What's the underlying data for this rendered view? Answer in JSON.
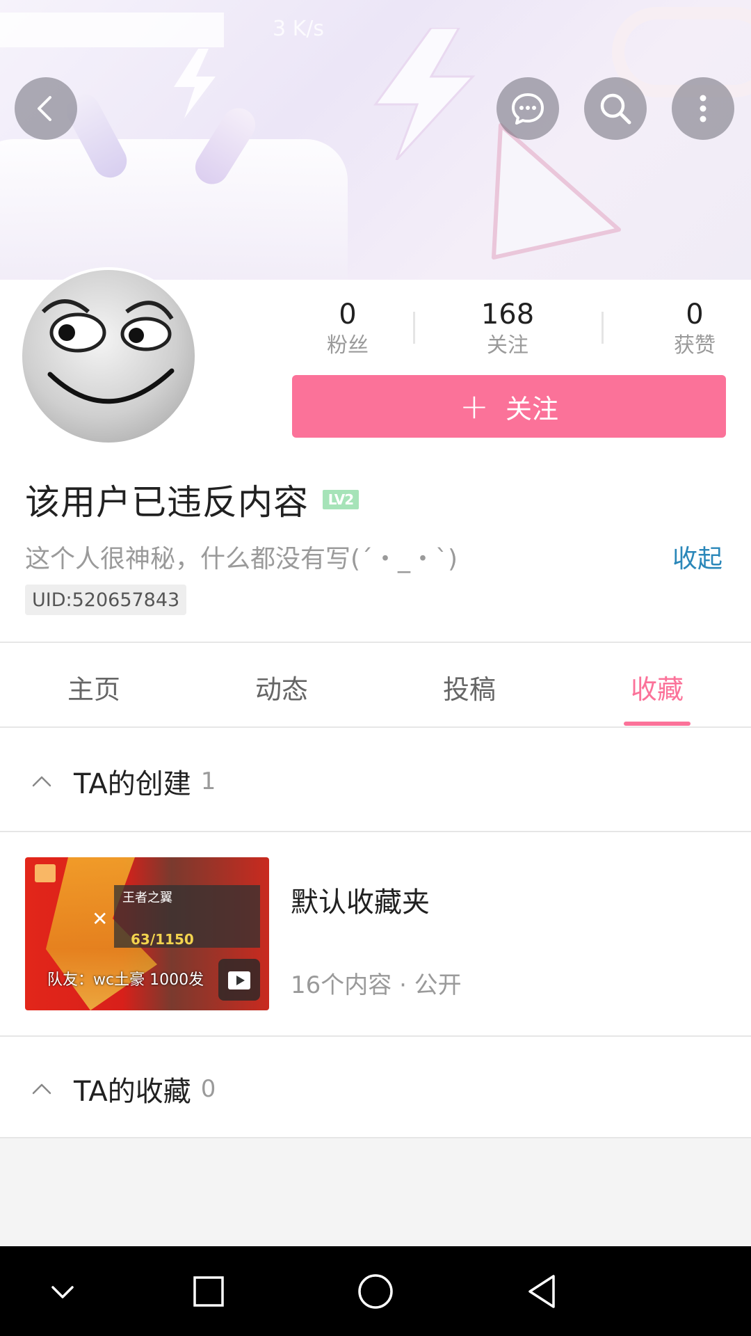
{
  "status_bar": {
    "network_speed": "3 K/s"
  },
  "header": {
    "back_icon": "chevron-left-icon",
    "message_icon": "chat-bubble-icon",
    "search_icon": "search-icon",
    "more_icon": "more-vertical-icon"
  },
  "profile": {
    "stats": [
      {
        "value": "0",
        "label": "粉丝"
      },
      {
        "value": "168",
        "label": "关注"
      },
      {
        "value": "0",
        "label": "获赞"
      }
    ],
    "follow_plus": "+",
    "follow_label": "关注",
    "name": "该用户已违反内容",
    "level": "LV2",
    "level_color": "#a6e3b8",
    "bio": "这个人很神秘，什么都没有写(´・_・`)",
    "collapse_label": "收起",
    "uid": "UID:520657843"
  },
  "tabs": [
    {
      "label": "主页"
    },
    {
      "label": "动态"
    },
    {
      "label": "投稿"
    },
    {
      "label": "收藏",
      "active": true
    }
  ],
  "accent_color": "#fb7299",
  "sections": {
    "created": {
      "title": "TA的创建",
      "count": "1"
    },
    "favorites": {
      "title": "TA的收藏",
      "count": "0"
    }
  },
  "folder": {
    "title": "默认收藏夹",
    "meta": "16个内容 · 公开",
    "thumb_overlay_title": "王者之翼",
    "thumb_ammo": "63/1150",
    "thumb_caption": "队友：wc土豪 1000发"
  },
  "nav_bar": [
    "chevron-down-icon",
    "square-icon",
    "circle-icon",
    "triangle-back-icon"
  ]
}
